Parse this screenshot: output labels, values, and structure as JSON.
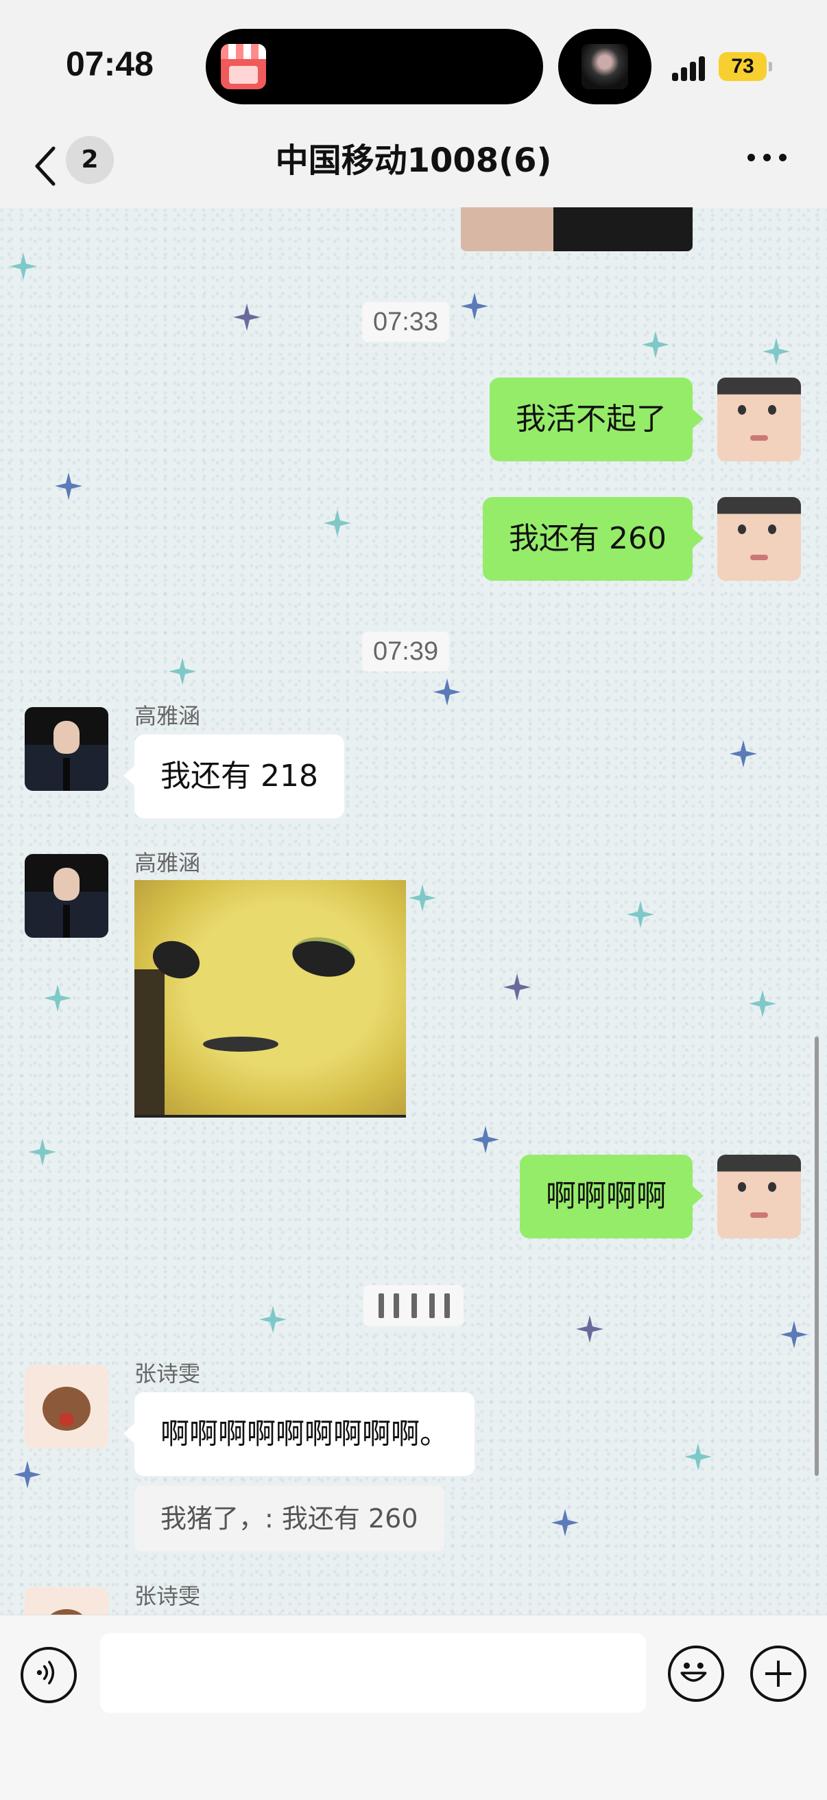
{
  "status_bar": {
    "time": "07:48",
    "battery": "73",
    "live_activity_label": "STORE"
  },
  "nav": {
    "unread_count": "2",
    "title": "中国移动1008(6)"
  },
  "messages": {
    "timestamp_1": "07:33",
    "me_1": "我活不起了",
    "me_2": "我还有 260",
    "timestamp_2": "07:39",
    "sender_gao_1": "高雅涵",
    "gao_text": "我还有 218",
    "sender_gao_2": "高雅涵",
    "me_3": "啊啊啊啊",
    "sender_zhang_1": "张诗雯",
    "zhang_text": "啊啊啊啊啊啊啊啊啊。",
    "zhang_quote": "我猪了，: 我还有 260",
    "sender_zhang_2": "张诗雯"
  },
  "input": {
    "placeholder": ""
  },
  "colors": {
    "my_bubble": "#95ec69",
    "other_bubble": "#ffffff",
    "battery": "#f7cf2f"
  },
  "icons": [
    "back-chevron-icon",
    "more-icon",
    "voice-icon",
    "emoji-icon",
    "plus-icon",
    "store-icon",
    "sparkle-icon"
  ]
}
